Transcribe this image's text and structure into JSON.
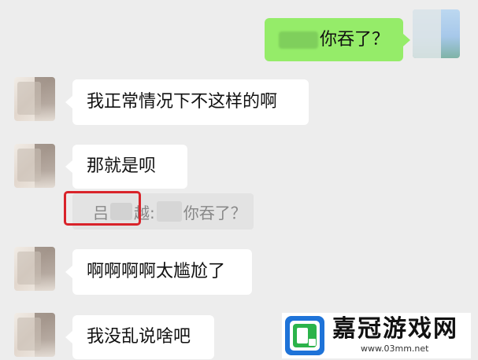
{
  "chat": {
    "outgoing": {
      "text": "你吞了？"
    },
    "messages": [
      {
        "text": "我正常情况下不这样的啊"
      },
      {
        "text": "那就是呗"
      },
      {
        "text": "啊啊啊啊太尴尬了"
      },
      {
        "text": "我没乱说啥吧"
      }
    ],
    "quote": {
      "name_start": "吕",
      "name_end": "越:",
      "text": "你吞了？"
    }
  },
  "watermark": {
    "title": "嘉冠游戏网",
    "url": "www.03mm.net"
  },
  "colors": {
    "outgoing_bubble": "#95ec69",
    "incoming_bubble": "#ffffff",
    "highlight_box": "#d9232a",
    "background": "#ededed"
  }
}
